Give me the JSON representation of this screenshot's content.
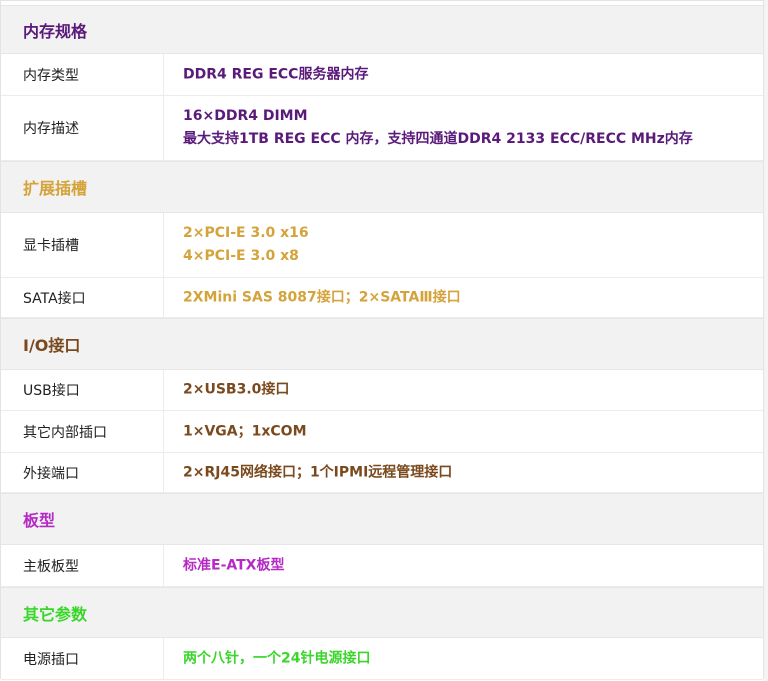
{
  "sections": [
    {
      "title": "内存规格",
      "color": "#5a1a7a",
      "rows": [
        {
          "label": "内存类型",
          "lines": [
            "DDR4 REG ECC服务器内存"
          ]
        },
        {
          "label": "内存描述",
          "lines": [
            "16×DDR4 DIMM",
            "最大支持1TB REG ECC 内存，支持四通道DDR4 2133 ECC/RECC MHz内存"
          ]
        }
      ]
    },
    {
      "title": "扩展插槽",
      "color": "#d4a33a",
      "rows": [
        {
          "label": "显卡插槽",
          "lines": [
            "2×PCI-E 3.0 x16",
            "4×PCI-E 3.0 x8"
          ]
        },
        {
          "label": "SATA接口",
          "lines": [
            "2XMini SAS 8087接口；2×SATAⅢ接口"
          ]
        }
      ]
    },
    {
      "title": "I/O接口",
      "color": "#7a4a1e",
      "rows": [
        {
          "label": "USB接口",
          "lines": [
            "2×USB3.0接口"
          ]
        },
        {
          "label": "其它内部插口",
          "lines": [
            "1×VGA；1xCOM"
          ]
        },
        {
          "label": "外接端口",
          "lines": [
            "2×RJ45网络接口；1个IPMI远程管理接口"
          ]
        }
      ]
    },
    {
      "title": "板型",
      "color": "#b52ac4",
      "rows": [
        {
          "label": "主板板型",
          "lines": [
            "标准E-ATX板型"
          ]
        }
      ]
    },
    {
      "title": "其它参数",
      "color": "#3bd62b",
      "rows": [
        {
          "label": "电源插口",
          "lines": [
            "两个八针，一个24针电源接口"
          ]
        }
      ]
    }
  ]
}
